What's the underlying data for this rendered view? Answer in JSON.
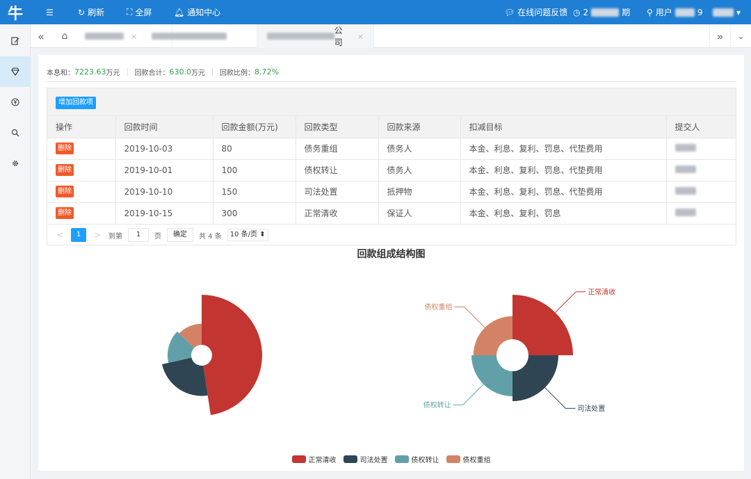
{
  "topbar": {
    "logo": "牛",
    "collapse_icon": "☰",
    "refresh_label": "刷新",
    "fullscreen_label": "全屏",
    "notice_label": "通知中心",
    "feedback_label": "在线问题反馈",
    "date_prefix": "2",
    "date_suffix": "期",
    "user_prefix": "用户",
    "user_suffix": "9"
  },
  "sidebar": [
    "edit-icon",
    "gem-icon",
    "yen-icon",
    "search-icon",
    "gear-icon"
  ],
  "tabs": {
    "active_suffix": "公司"
  },
  "summary": {
    "principal_label": "本息和：",
    "principal_value": "7223.63",
    "principal_unit": "万元",
    "repay_label": "回款合计：",
    "repay_value": "630.0",
    "repay_unit": "万元",
    "ratio_label": "回款比例：",
    "ratio_value": "8.72%"
  },
  "table": {
    "add_button": "增加回款项",
    "headers": [
      "操作",
      "回款时间",
      "回款金额(万元)",
      "回款类型",
      "回款来源",
      "扣减目标",
      "提交人"
    ],
    "delete_label": "删除",
    "rows": [
      {
        "date": "2019-10-03",
        "amount": "80",
        "type": "债务重组",
        "source": "债务人",
        "target": "本金、利息、复利、罚息、代垫费用"
      },
      {
        "date": "2019-10-01",
        "amount": "100",
        "type": "债权转让",
        "source": "债务人",
        "target": "本金、利息、复利、罚息、代垫费用"
      },
      {
        "date": "2019-10-10",
        "amount": "150",
        "type": "司法处置",
        "source": "抵押物",
        "target": "本金、利息、复利、罚息、代垫费用"
      },
      {
        "date": "2019-10-15",
        "amount": "300",
        "type": "正常清收",
        "source": "保证人",
        "target": "本金、利息、复利、罚息"
      }
    ]
  },
  "pager": {
    "prev": "<",
    "page": "1",
    "next": ">",
    "goto_label": "到第",
    "goto_value": "1",
    "page_unit": "页",
    "confirm": "确定",
    "total": "共 4 条",
    "page_size": "10 条/页"
  },
  "chart_data": {
    "type": "pie",
    "variant": "rose",
    "title": "回款组成结构图",
    "categories": [
      "正常清收",
      "司法处置",
      "债权转让",
      "债权重组"
    ],
    "values": [
      300,
      150,
      100,
      80
    ],
    "colors": [
      "#c23531",
      "#2f4554",
      "#61a0a8",
      "#d48265"
    ],
    "legend_position": "bottom-center",
    "charts": [
      {
        "roseType": "radius",
        "labels": false
      },
      {
        "roseType": "area",
        "labels": true
      }
    ]
  }
}
